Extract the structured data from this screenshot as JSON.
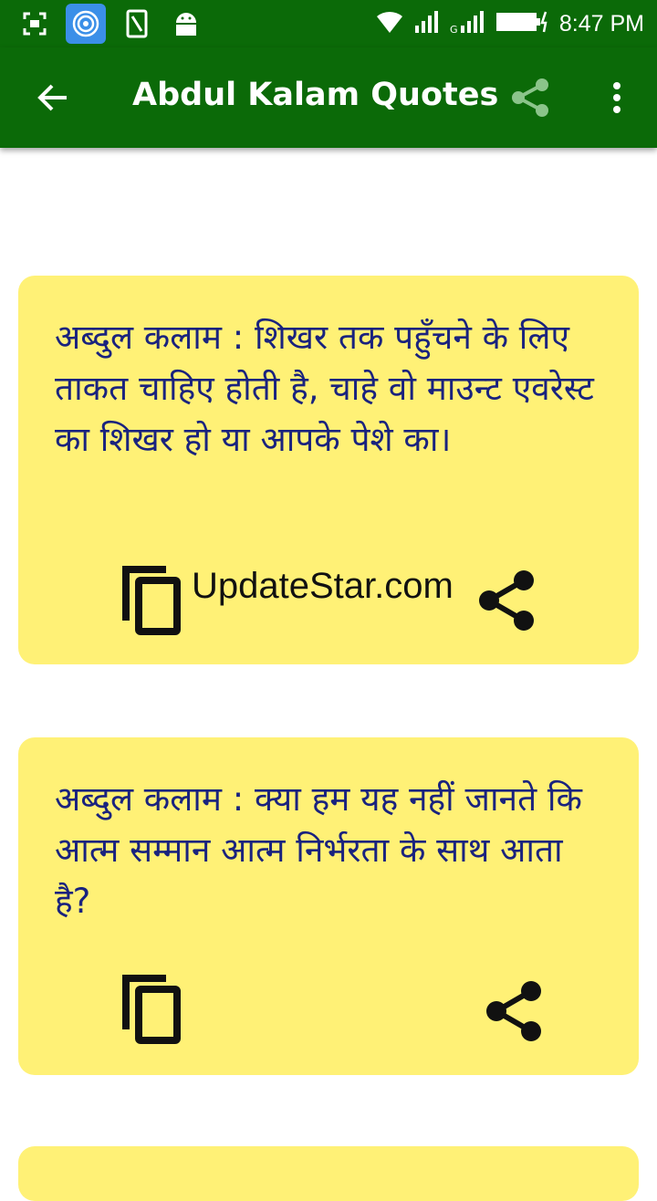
{
  "status_bar": {
    "time": "8:47 PM",
    "icons": [
      "screenshot-icon",
      "hotspot-icon",
      "sim-icon",
      "android-icon",
      "wifi-icon",
      "signal-icon",
      "signal-icon",
      "battery-icon"
    ]
  },
  "app_bar": {
    "title": "Abdul Kalam Quotes",
    "back_icon": "arrow-back-icon",
    "share_icon": "share-icon",
    "menu_icon": "more-vert-icon"
  },
  "quotes": [
    {
      "text": "अब्दुल कलाम : शिखर तक पहुँचने के लिए ताकत चाहिए होती है, चाहे वो माउन्ट एवरेस्ट का शिखर हो या आपके पेशे का।",
      "watermark": "UpdateStar.com"
    },
    {
      "text": "अब्दुल कलाम : क्या हम यह नहीं जानते कि आत्म सम्मान आत्म निर्भरता के साथ आता है?"
    }
  ],
  "colors": {
    "app_bar": "#0b6a08",
    "card": "#fff176",
    "quote_text": "#1a237e"
  }
}
